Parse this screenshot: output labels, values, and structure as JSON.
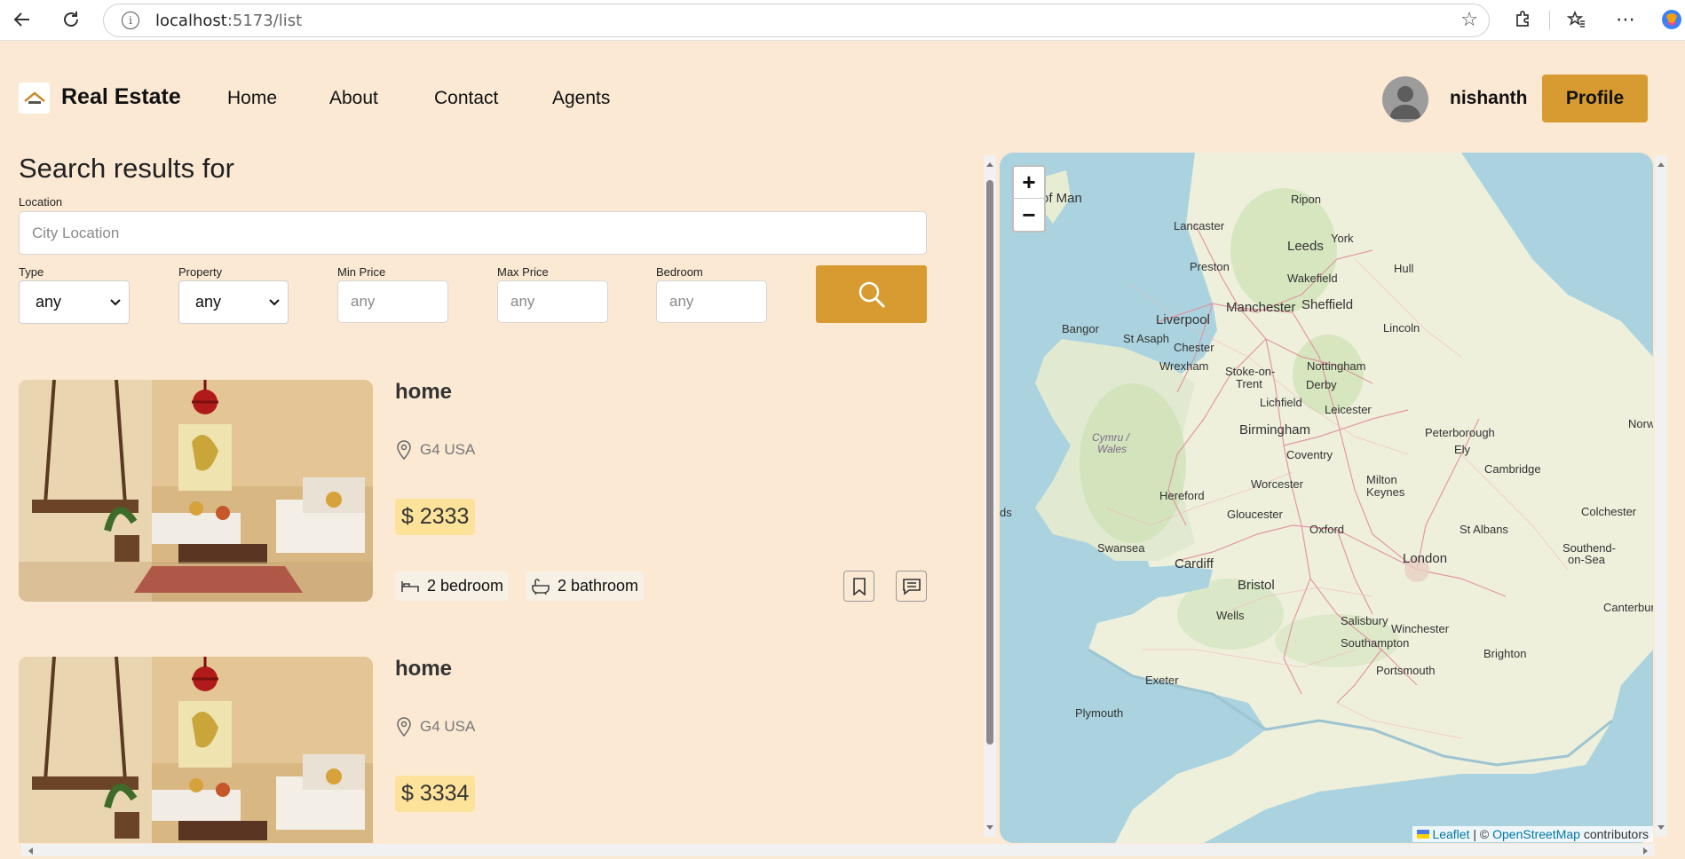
{
  "browser": {
    "url_host": "localhost",
    "url_path": ":5173/list"
  },
  "navbar": {
    "brand": "Real Estate",
    "links": [
      "Home",
      "About",
      "Contact",
      "Agents"
    ],
    "username": "nishanth",
    "profile_label": "Profile"
  },
  "search": {
    "title": "Search results for",
    "location_label": "Location",
    "location_placeholder": "City Location",
    "type_label": "Type",
    "type_value": "any",
    "property_label": "Property",
    "property_value": "any",
    "min_price_label": "Min Price",
    "min_price_placeholder": "any",
    "max_price_label": "Max Price",
    "max_price_placeholder": "any",
    "bedroom_label": "Bedroom",
    "bedroom_placeholder": "any"
  },
  "listings": [
    {
      "title": "home",
      "address": "G4 USA",
      "price": "$ 2333",
      "bedroom": "2 bedroom",
      "bathroom": "2 bathroom"
    },
    {
      "title": "home",
      "address": "G4 USA",
      "price": "$ 3334"
    }
  ],
  "map": {
    "zoom_in": "+",
    "zoom_out": "−",
    "attribution_leaflet": "Leaflet",
    "attribution_sep": " | © ",
    "attribution_osm": "OpenStreetMap",
    "attribution_contrib": " contributors",
    "labels": [
      "of Man",
      "Lancaster",
      "Ripon",
      "Leeds",
      "York",
      "Preston",
      "Hull",
      "Wakefield",
      "Manchester",
      "Sheffield",
      "Liverpool",
      "Bangor",
      "St Asaph",
      "Chester",
      "Lincoln",
      "Wrexham",
      "Stoke-on-",
      "Trent",
      "Nottingham",
      "Derby",
      "Lichfield",
      "Leicester",
      "Norw",
      "Cymru /",
      "Wales",
      "Birmingham",
      "Peterborough",
      "Ely",
      "Coventry",
      "Cambridge",
      "Hereford",
      "Worcester",
      "Milton",
      "Keynes",
      "ds",
      "Gloucester",
      "Colchester",
      "Swansea",
      "Oxford",
      "St Albans",
      "Southend-",
      "on-Sea",
      "Cardiff",
      "London",
      "Bristol",
      "Canterbur",
      "Wells",
      "Salisbury",
      "Winchester",
      "Southampton",
      "Brighton",
      "Portsmouth",
      "Exeter",
      "Plymouth"
    ]
  }
}
